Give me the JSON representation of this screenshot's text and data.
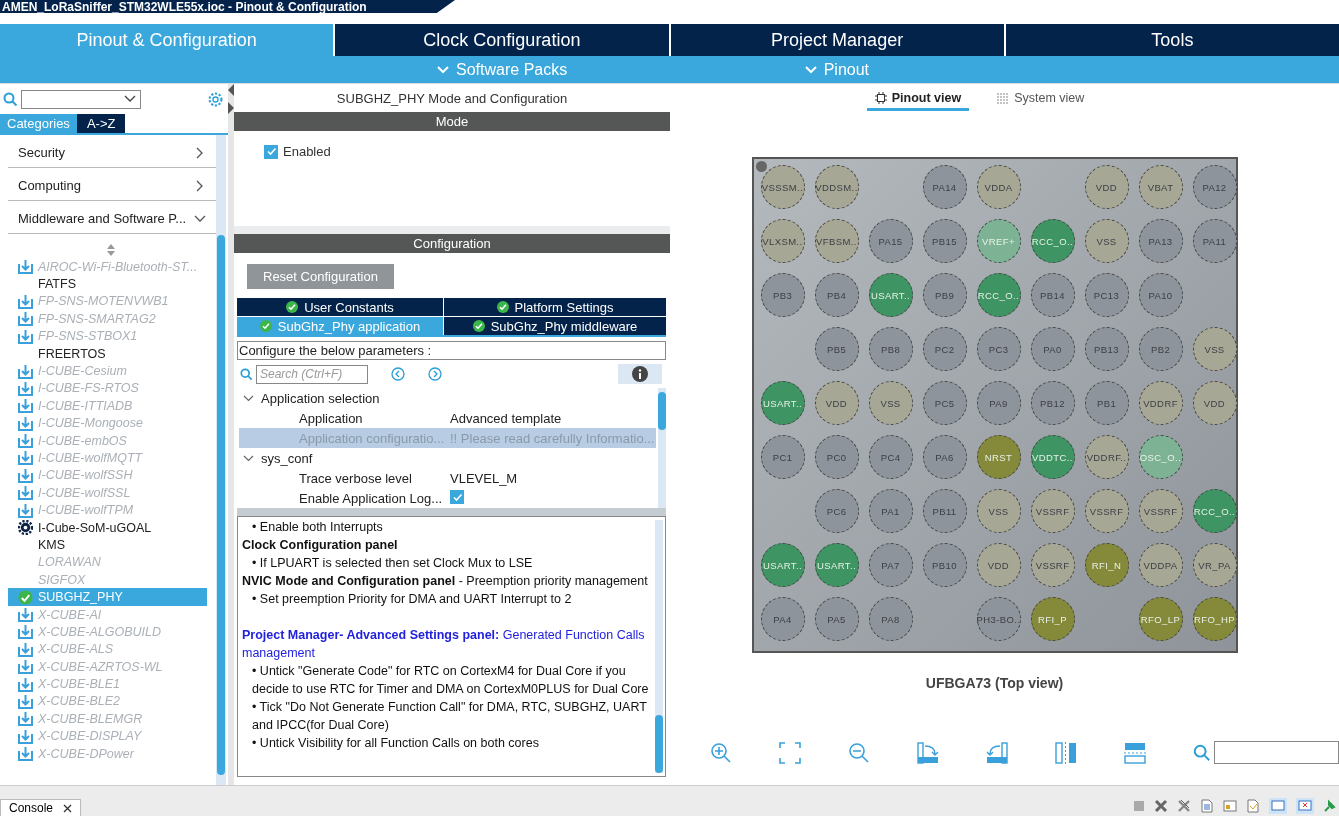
{
  "window": {
    "title": "AMEN_LoRaSniffer_STM32WLE55x.ioc - Pinout & Configuration"
  },
  "main_tabs": [
    {
      "label": "Pinout & Configuration",
      "selected": true
    },
    {
      "label": "Clock Configuration",
      "selected": false
    },
    {
      "label": "Project Manager",
      "selected": false
    },
    {
      "label": "Tools",
      "selected": false
    }
  ],
  "sub_menus": [
    {
      "label": "Software Packs"
    },
    {
      "label": "Pinout"
    }
  ],
  "sidebar": {
    "view_tabs": [
      {
        "label": "Categories",
        "selected": true
      },
      {
        "label": "A->Z",
        "selected": false
      }
    ],
    "categories": [
      {
        "label": "Security",
        "expanded": false
      },
      {
        "label": "Computing",
        "expanded": false
      },
      {
        "label": "Middleware and Software P...",
        "expanded": true
      }
    ],
    "items": [
      {
        "label": "AIROC-Wi-Fi-Bluetooth-ST...",
        "kind": "pack",
        "selected": false
      },
      {
        "label": "FATFS",
        "kind": "component",
        "selected": false
      },
      {
        "label": "FP-SNS-MOTENVWB1",
        "kind": "pack",
        "selected": false
      },
      {
        "label": "FP-SNS-SMARTAG2",
        "kind": "pack",
        "selected": false
      },
      {
        "label": "FP-SNS-STBOX1",
        "kind": "pack",
        "selected": false
      },
      {
        "label": "FREERTOS",
        "kind": "component",
        "selected": false
      },
      {
        "label": "I-CUBE-Cesium",
        "kind": "pack",
        "selected": false
      },
      {
        "label": "I-CUBE-FS-RTOS",
        "kind": "pack",
        "selected": false
      },
      {
        "label": "I-CUBE-ITTIADB",
        "kind": "pack",
        "selected": false
      },
      {
        "label": "I-CUBE-Mongoose",
        "kind": "pack",
        "selected": false
      },
      {
        "label": "I-CUBE-embOS",
        "kind": "pack",
        "selected": false
      },
      {
        "label": "I-CUBE-wolfMQTT",
        "kind": "pack",
        "selected": false
      },
      {
        "label": "I-CUBE-wolfSSH",
        "kind": "pack",
        "selected": false
      },
      {
        "label": "I-CUBE-wolfSSL",
        "kind": "pack",
        "selected": false
      },
      {
        "label": "I-CUBE-wolfTPM",
        "kind": "pack",
        "selected": false
      },
      {
        "label": "I-Cube-SoM-uGOAL",
        "kind": "custom",
        "selected": false
      },
      {
        "label": "KMS",
        "kind": "component",
        "selected": false
      },
      {
        "label": "LORAWAN",
        "kind": "unavailable",
        "selected": false
      },
      {
        "label": "SIGFOX",
        "kind": "unavailable",
        "selected": false
      },
      {
        "label": "SUBGHZ_PHY",
        "kind": "enabled",
        "selected": true
      },
      {
        "label": "X-CUBE-AI",
        "kind": "pack",
        "selected": false
      },
      {
        "label": "X-CUBE-ALGOBUILD",
        "kind": "pack",
        "selected": false
      },
      {
        "label": "X-CUBE-ALS",
        "kind": "pack",
        "selected": false
      },
      {
        "label": "X-CUBE-AZRTOS-WL",
        "kind": "pack",
        "selected": false
      },
      {
        "label": "X-CUBE-BLE1",
        "kind": "pack",
        "selected": false
      },
      {
        "label": "X-CUBE-BLE2",
        "kind": "pack",
        "selected": false
      },
      {
        "label": "X-CUBE-BLEMGR",
        "kind": "pack",
        "selected": false
      },
      {
        "label": "X-CUBE-DISPLAY",
        "kind": "pack",
        "selected": false
      },
      {
        "label": "X-CUBE-DPower",
        "kind": "pack",
        "selected": false
      }
    ]
  },
  "config_panel": {
    "title": "SUBGHZ_PHY Mode and Configuration",
    "mode_header": "Mode",
    "mode_enabled": {
      "label": "Enabled",
      "checked": true
    },
    "config_header": "Configuration",
    "reset_button": {
      "label": "Reset Configuration",
      "disabled": true
    },
    "tabs": [
      {
        "label": "User Constants",
        "selected": false
      },
      {
        "label": "Platform Settings",
        "selected": false
      },
      {
        "label": "SubGhz_Phy application",
        "selected": true
      },
      {
        "label": "SubGhz_Phy middleware",
        "selected": false
      }
    ],
    "hint": "Configure the below parameters :",
    "search": {
      "placeholder": "Search (Ctrl+F)"
    },
    "tree": [
      {
        "label": "Application selection",
        "expanded": true,
        "children": [
          {
            "label": "Application",
            "value": "Advanced template",
            "kind": "text",
            "selected": false,
            "disabled": false
          },
          {
            "label": "Application configuratio...",
            "value": "!! Please read carefully Informatio...",
            "kind": "text",
            "selected": true,
            "disabled": true
          }
        ]
      },
      {
        "label": "sys_conf",
        "expanded": true,
        "children": [
          {
            "label": "Trace verbose level",
            "value": "VLEVEL_M",
            "kind": "text",
            "selected": false,
            "disabled": false
          },
          {
            "label": "Enable Application Log...",
            "checked": true,
            "kind": "checkbox",
            "selected": false,
            "disabled": false
          }
        ]
      }
    ],
    "description": [
      {
        "kind": "bullet",
        "text": "• Enable both Interrupts"
      },
      {
        "kind": "heading",
        "text": "Clock Configuration panel"
      },
      {
        "kind": "bullet",
        "text": "• If LPUART is selected then set Clock Mux to LSE"
      },
      {
        "kind": "heading",
        "text": "**NVIC Mode and Configuration panel** - Preemption priority management"
      },
      {
        "kind": "bullet",
        "text": "• Set preemption Priority for DMA and UART Interrupt to 2"
      },
      {
        "kind": "link",
        "text": "**Project Manager- Advanced Settings panel:** Generated Function Calls management"
      },
      {
        "kind": "bullet",
        "text": "• Untick \"Generate Code\" for RTC on CortexM4 for Dual Core if you decide to use RTC for Timer and DMA on CortexM0PLUS for Dual Core"
      },
      {
        "kind": "bullet",
        "text": "• Tick \"Do Not Generate Function Call\" for DMA, RTC, SUBGHZ, UART and IPCC(for Dual Core)"
      },
      {
        "kind": "bullet",
        "text": "• Untick Visibility for all Function Calls on both cores"
      }
    ]
  },
  "pinout": {
    "view_tabs": [
      {
        "label": "Pinout view",
        "selected": true
      },
      {
        "label": "System view",
        "selected": false
      }
    ],
    "rows": [
      [
        {
          "label": "VSSSM..",
          "color": "#a7a796"
        },
        {
          "label": "VDDSM..",
          "color": "#a7a796"
        },
        null,
        {
          "label": "PA14",
          "color": "#8e949b"
        },
        {
          "label": "VDDA",
          "color": "#a7a796"
        },
        null,
        {
          "label": "VDD",
          "color": "#a7a796"
        },
        {
          "label": "VBAT",
          "color": "#a7a796"
        },
        {
          "label": "PA12",
          "color": "#8e949b"
        }
      ],
      [
        {
          "label": "VLXSM..",
          "color": "#a7a796"
        },
        {
          "label": "VFBSM..",
          "color": "#a7a796"
        },
        {
          "label": "PA15",
          "color": "#8e949b"
        },
        {
          "label": "PB15",
          "color": "#8e949b"
        },
        {
          "label": "VREF+",
          "color": "#7db394"
        },
        {
          "label": "RCC_O..",
          "color": "#3f9463"
        },
        {
          "label": "VSS",
          "color": "#a7a796"
        },
        {
          "label": "PA13",
          "color": "#8e949b"
        },
        {
          "label": "PA11",
          "color": "#8e949b"
        }
      ],
      [
        {
          "label": "PB3",
          "color": "#8e949b"
        },
        {
          "label": "PB4",
          "color": "#8e949b"
        },
        {
          "label": "USART..",
          "color": "#3f9463"
        },
        {
          "label": "PB9",
          "color": "#8e949b"
        },
        {
          "label": "RCC_O..",
          "color": "#3f9463"
        },
        {
          "label": "PB14",
          "color": "#8e949b"
        },
        {
          "label": "PC13",
          "color": "#8e949b"
        },
        {
          "label": "PA10",
          "color": "#8e949b"
        },
        null
      ],
      [
        null,
        {
          "label": "PB5",
          "color": "#8e949b"
        },
        {
          "label": "PB8",
          "color": "#8e949b"
        },
        {
          "label": "PC2",
          "color": "#8e949b"
        },
        {
          "label": "PC3",
          "color": "#8e949b"
        },
        {
          "label": "PA0",
          "color": "#8e949b"
        },
        {
          "label": "PB13",
          "color": "#8e949b"
        },
        {
          "label": "PB2",
          "color": "#8e949b"
        },
        {
          "label": "VSS",
          "color": "#a7a796"
        }
      ],
      [
        {
          "label": "USART..",
          "color": "#3f9463"
        },
        {
          "label": "VDD",
          "color": "#a7a796"
        },
        {
          "label": "VSS",
          "color": "#a7a796"
        },
        {
          "label": "PC5",
          "color": "#8e949b"
        },
        {
          "label": "PA9",
          "color": "#8e949b"
        },
        {
          "label": "PB12",
          "color": "#8e949b"
        },
        {
          "label": "PB1",
          "color": "#8e949b"
        },
        {
          "label": "VDDRF",
          "color": "#a7a796"
        },
        {
          "label": "VDD",
          "color": "#a7a796"
        }
      ],
      [
        {
          "label": "PC1",
          "color": "#8e949b"
        },
        {
          "label": "PC0",
          "color": "#8e949b"
        },
        {
          "label": "PC4",
          "color": "#8e949b"
        },
        {
          "label": "PA6",
          "color": "#8e949b"
        },
        {
          "label": "NRST",
          "color": "#848a3a"
        },
        {
          "label": "VDDTC..",
          "color": "#3f9463"
        },
        {
          "label": "VDDRF..",
          "color": "#a7a796"
        },
        {
          "label": "OSC_O..",
          "color": "#7db394"
        },
        null
      ],
      [
        null,
        {
          "label": "PC6",
          "color": "#8e949b"
        },
        {
          "label": "PA1",
          "color": "#8e949b"
        },
        {
          "label": "PB11",
          "color": "#8e949b"
        },
        {
          "label": "VSS",
          "color": "#a7a796"
        },
        {
          "label": "VSSRF",
          "color": "#a7a796"
        },
        {
          "label": "VSSRF",
          "color": "#a7a796"
        },
        {
          "label": "VSSRF",
          "color": "#a7a796"
        },
        {
          "label": "RCC_O..",
          "color": "#3f9463"
        }
      ],
      [
        {
          "label": "USART..",
          "color": "#3f9463"
        },
        {
          "label": "USART..",
          "color": "#3f9463"
        },
        {
          "label": "PA7",
          "color": "#8e949b"
        },
        {
          "label": "PB10",
          "color": "#8e949b"
        },
        {
          "label": "VDD",
          "color": "#a7a796"
        },
        {
          "label": "VSSRF",
          "color": "#a7a796"
        },
        {
          "label": "RFI_N",
          "color": "#848a3a"
        },
        {
          "label": "VDDPA",
          "color": "#a7a796"
        },
        {
          "label": "VR_PA",
          "color": "#a7a796"
        }
      ],
      [
        {
          "label": "PA4",
          "color": "#8e949b"
        },
        {
          "label": "PA5",
          "color": "#8e949b"
        },
        {
          "label": "PA8",
          "color": "#8e949b"
        },
        null,
        {
          "label": "PH3-BO..",
          "color": "#8e949b"
        },
        {
          "label": "RFI_P",
          "color": "#848a3a"
        },
        null,
        {
          "label": "RFO_LP",
          "color": "#848a3a"
        },
        {
          "label": "RFO_HP",
          "color": "#848a3a"
        }
      ]
    ],
    "caption": "UFBGA73 (Top view)"
  },
  "bottom_bar": {
    "tab": "Console"
  }
}
